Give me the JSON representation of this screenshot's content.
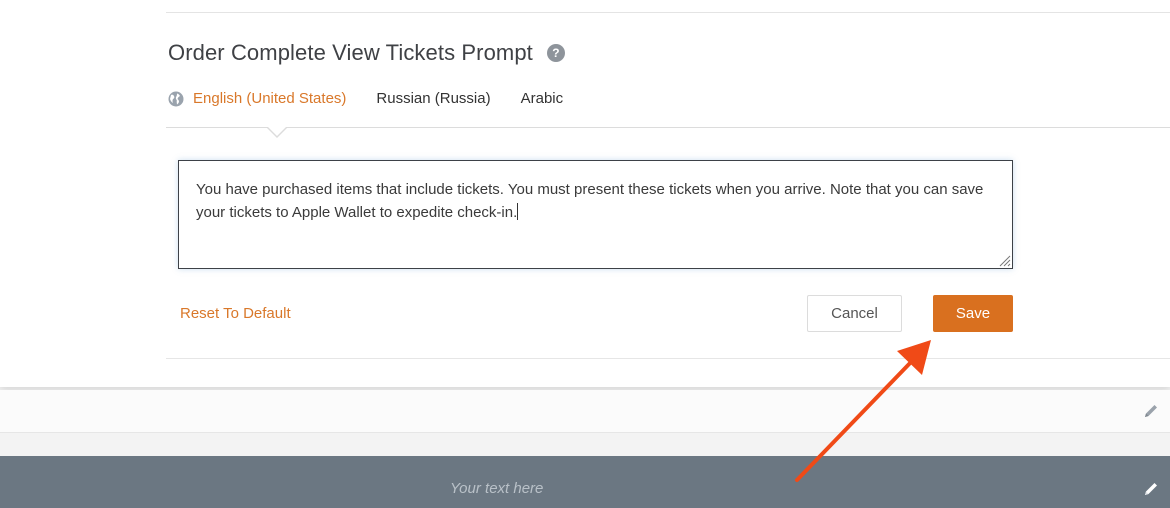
{
  "header": {
    "title": "Order Complete View Tickets Prompt",
    "help_icon": "question-circle-icon"
  },
  "tabs": [
    {
      "label": "English (United States)",
      "active": true,
      "icon": "globe-icon"
    },
    {
      "label": "Russian (Russia)",
      "active": false
    },
    {
      "label": "Arabic",
      "active": false
    }
  ],
  "editor": {
    "value": "You have purchased items that include tickets. You must present these tickets when you arrive. Note that you can save your tickets to Apple Wallet to expedite check-in."
  },
  "actions": {
    "reset_label": "Reset To Default",
    "cancel_label": "Cancel",
    "save_label": "Save"
  },
  "footer": {
    "placeholder": "Your text here",
    "edit_icon": "pencil-icon"
  },
  "colors": {
    "accent": "#d9782a",
    "save_button": "#d9701f",
    "footer_bar": "#6b7782",
    "annotation_arrow": "#f04a17"
  }
}
